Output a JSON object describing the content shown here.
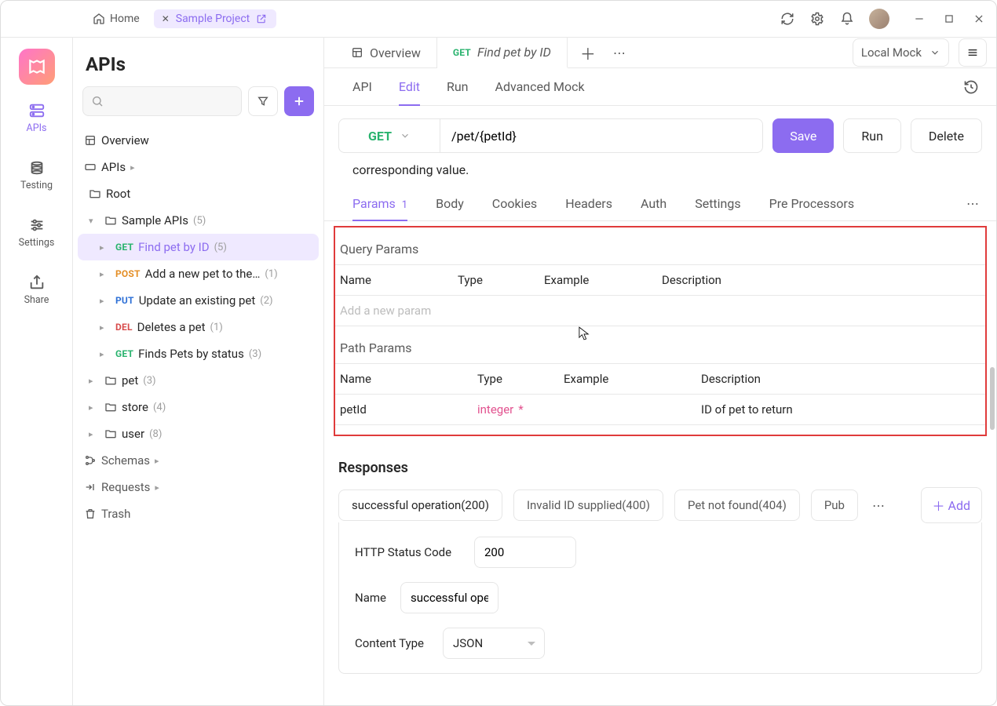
{
  "titlebar": {
    "home": "Home",
    "project": "Sample Project"
  },
  "rail": {
    "apis": "APIs",
    "testing": "Testing",
    "settings": "Settings",
    "share": "Share"
  },
  "sidebar": {
    "title": "APIs",
    "overview": "Overview",
    "apis_label": "APIs",
    "root": "Root",
    "sample_apis": "Sample APIs",
    "sample_apis_count": "(5)",
    "items": [
      {
        "method": "GET",
        "label": "Find pet by ID",
        "count": "(5)"
      },
      {
        "method": "POST",
        "label": "Add a new pet to the…",
        "count": "(1)"
      },
      {
        "method": "PUT",
        "label": "Update an existing pet",
        "count": "(2)"
      },
      {
        "method": "DEL",
        "label": "Deletes a pet",
        "count": "(1)"
      },
      {
        "method": "GET",
        "label": "Finds Pets by status",
        "count": "(3)"
      }
    ],
    "folders": [
      {
        "label": "pet",
        "count": "(3)"
      },
      {
        "label": "store",
        "count": "(4)"
      },
      {
        "label": "user",
        "count": "(8)"
      }
    ],
    "schemas": "Schemas",
    "requests": "Requests",
    "trash": "Trash"
  },
  "tabs": {
    "overview": "Overview",
    "active_method": "GET",
    "active_label": "Find pet by ID",
    "env": "Local Mock"
  },
  "sub_tabs": [
    "API",
    "Edit",
    "Run",
    "Advanced Mock"
  ],
  "request": {
    "method": "GET",
    "url": "/pet/{petId}",
    "save": "Save",
    "run": "Run",
    "delete": "Delete",
    "desc_fragment": "corresponding value."
  },
  "param_tabs": {
    "params": "Params",
    "params_badge": "1",
    "body": "Body",
    "cookies": "Cookies",
    "headers": "Headers",
    "auth": "Auth",
    "settings": "Settings",
    "pre": "Pre Processors"
  },
  "query": {
    "title": "Query Params",
    "cols": [
      "Name",
      "Type",
      "Example",
      "Description"
    ],
    "placeholder": "Add a new param"
  },
  "path": {
    "title": "Path Params",
    "cols": [
      "Name",
      "Type",
      "Example",
      "Description"
    ],
    "row": {
      "name": "petId",
      "type": "integer",
      "example": "",
      "desc": "ID of pet to return"
    }
  },
  "responses": {
    "title": "Responses",
    "tabs": [
      "successful operation(200)",
      "Invalid ID supplied(400)",
      "Pet not found(404)",
      "Pub"
    ],
    "add": "Add",
    "status_label": "HTTP Status Code",
    "status_value": "200",
    "name_label": "Name",
    "name_value": "successful oper",
    "ct_label": "Content Type",
    "ct_value": "JSON"
  }
}
